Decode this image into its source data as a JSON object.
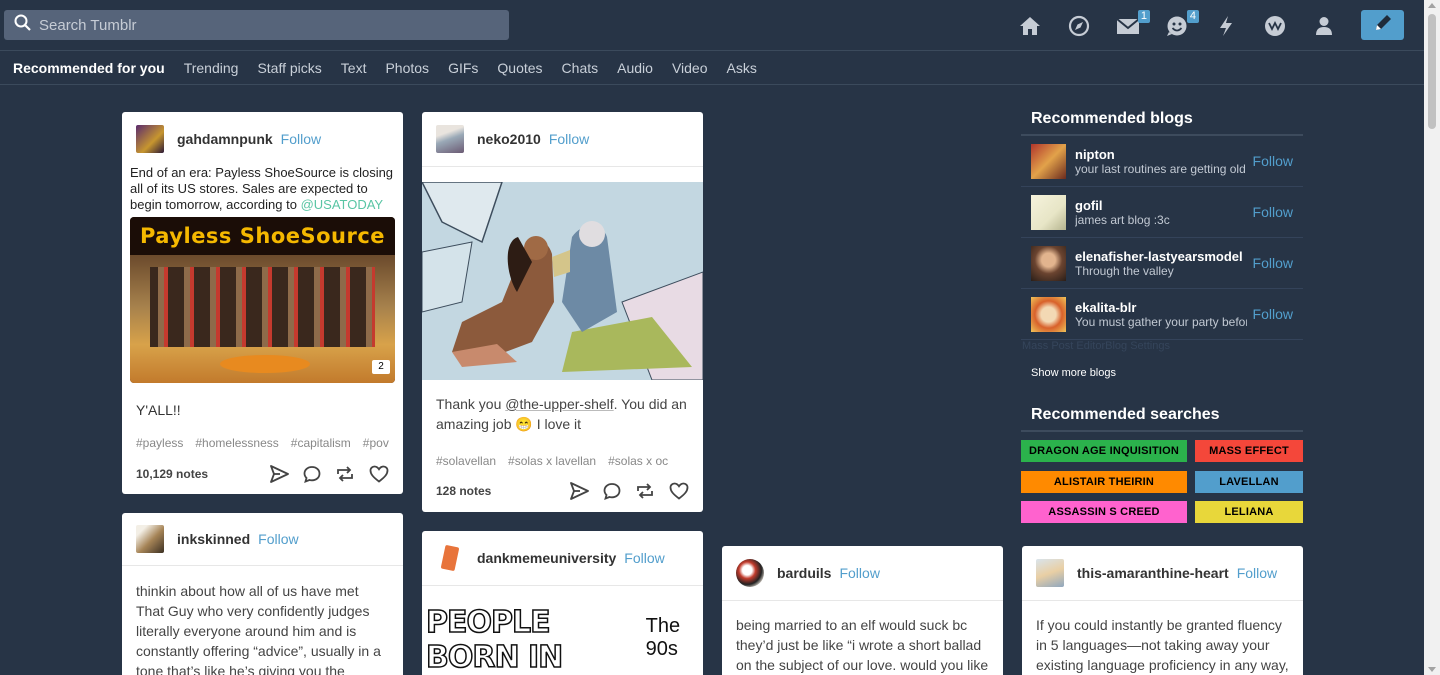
{
  "search": {
    "placeholder": "Search Tumblr"
  },
  "nav": {
    "icons": [
      "home-icon",
      "explore-icon",
      "inbox-icon",
      "messaging-icon",
      "activity-icon",
      "tumblr-tv-icon",
      "account-icon",
      "compose-icon"
    ],
    "inbox_badge": "1",
    "messaging_badge": "4"
  },
  "tabs": [
    "Recommended for you",
    "Trending",
    "Staff picks",
    "Text",
    "Photos",
    "GIFs",
    "Quotes",
    "Chats",
    "Audio",
    "Video",
    "Asks"
  ],
  "posts": {
    "p1": {
      "blog": "gahdamnpunk",
      "follow": "Follow",
      "text": "End of an era: Payless ShoeSource is closing all of its US stores. Sales are expected to begin tomorrow, according to",
      "mention": "@USATODAY",
      "image_sign": "Payless ShoeSource",
      "image_count": "2",
      "caption": "Y'ALL!!",
      "tags": [
        "#payless",
        "#homelessness",
        "#capitalism",
        "#pov"
      ],
      "notes": "10,129 notes"
    },
    "p2": {
      "blog": "neko2010",
      "follow": "Follow",
      "text_a": "Thank you ",
      "text_link": "@the-upper-shelf",
      "text_b": ". You did an amazing job 😁 I love it",
      "tags": [
        "#solavellan",
        "#solas x lavellan",
        "#solas x oc"
      ],
      "notes": "128 notes"
    },
    "p3": {
      "blog": "inkskinned",
      "follow": "Follow",
      "text": "thinkin about how all of us have met That Guy who very confidently judges literally everyone around him and is constantly offering “advice”, usually in a tone that’s like he’s giving you the biggest gift of his"
    },
    "p4": {
      "blog": "dankmemeuniversity",
      "follow": "Follow",
      "meme_big": "PEOPLE BORN IN",
      "meme_small": "The 90s"
    },
    "p5": {
      "blog": "barduils",
      "follow": "Follow",
      "text": "being married to an elf would suck bc they’d just be like “i wrote a short ballad on the subject of our love. would you like to"
    },
    "p6": {
      "blog": "this-amaranthine-heart",
      "follow": "Follow",
      "text": "If you could instantly be granted fluency in 5 languages—not taking away your existing language proficiency in any way,"
    }
  },
  "sidebar": {
    "blogs_title": "Recommended blogs",
    "blogs": [
      {
        "name": "nipton",
        "desc": "your last routines are getting old",
        "follow": "Follow"
      },
      {
        "name": "gofil",
        "desc": "james art blog :3c",
        "follow": "Follow"
      },
      {
        "name": "elenafisher-lastyearsmodel",
        "desc": "Through the valley",
        "follow": "Follow"
      },
      {
        "name": "ekalita-blr",
        "desc": "You must gather your party before",
        "follow": "Follow"
      }
    ],
    "faint_links": "Mass Post EditorBlog Settings",
    "show_more": "Show more blogs",
    "searches_title": "Recommended searches",
    "searches": [
      {
        "label": "DRAGON AGE INQUISITION",
        "color": "#2bb24c"
      },
      {
        "label": "MASS EFFECT",
        "color": "#f4473a"
      },
      {
        "label": "ALISTAIR THEIRIN",
        "color": "#ff8a00"
      },
      {
        "label": "LAVELLAN",
        "color": "#529ecc"
      },
      {
        "label": "ASSASSIN S CREED",
        "color": "#ff62ce"
      },
      {
        "label": "LELIANA",
        "color": "#e8d73a"
      }
    ]
  },
  "colors": {
    "background": "#273446",
    "accent": "#529ecc",
    "card": "#ffffff"
  }
}
